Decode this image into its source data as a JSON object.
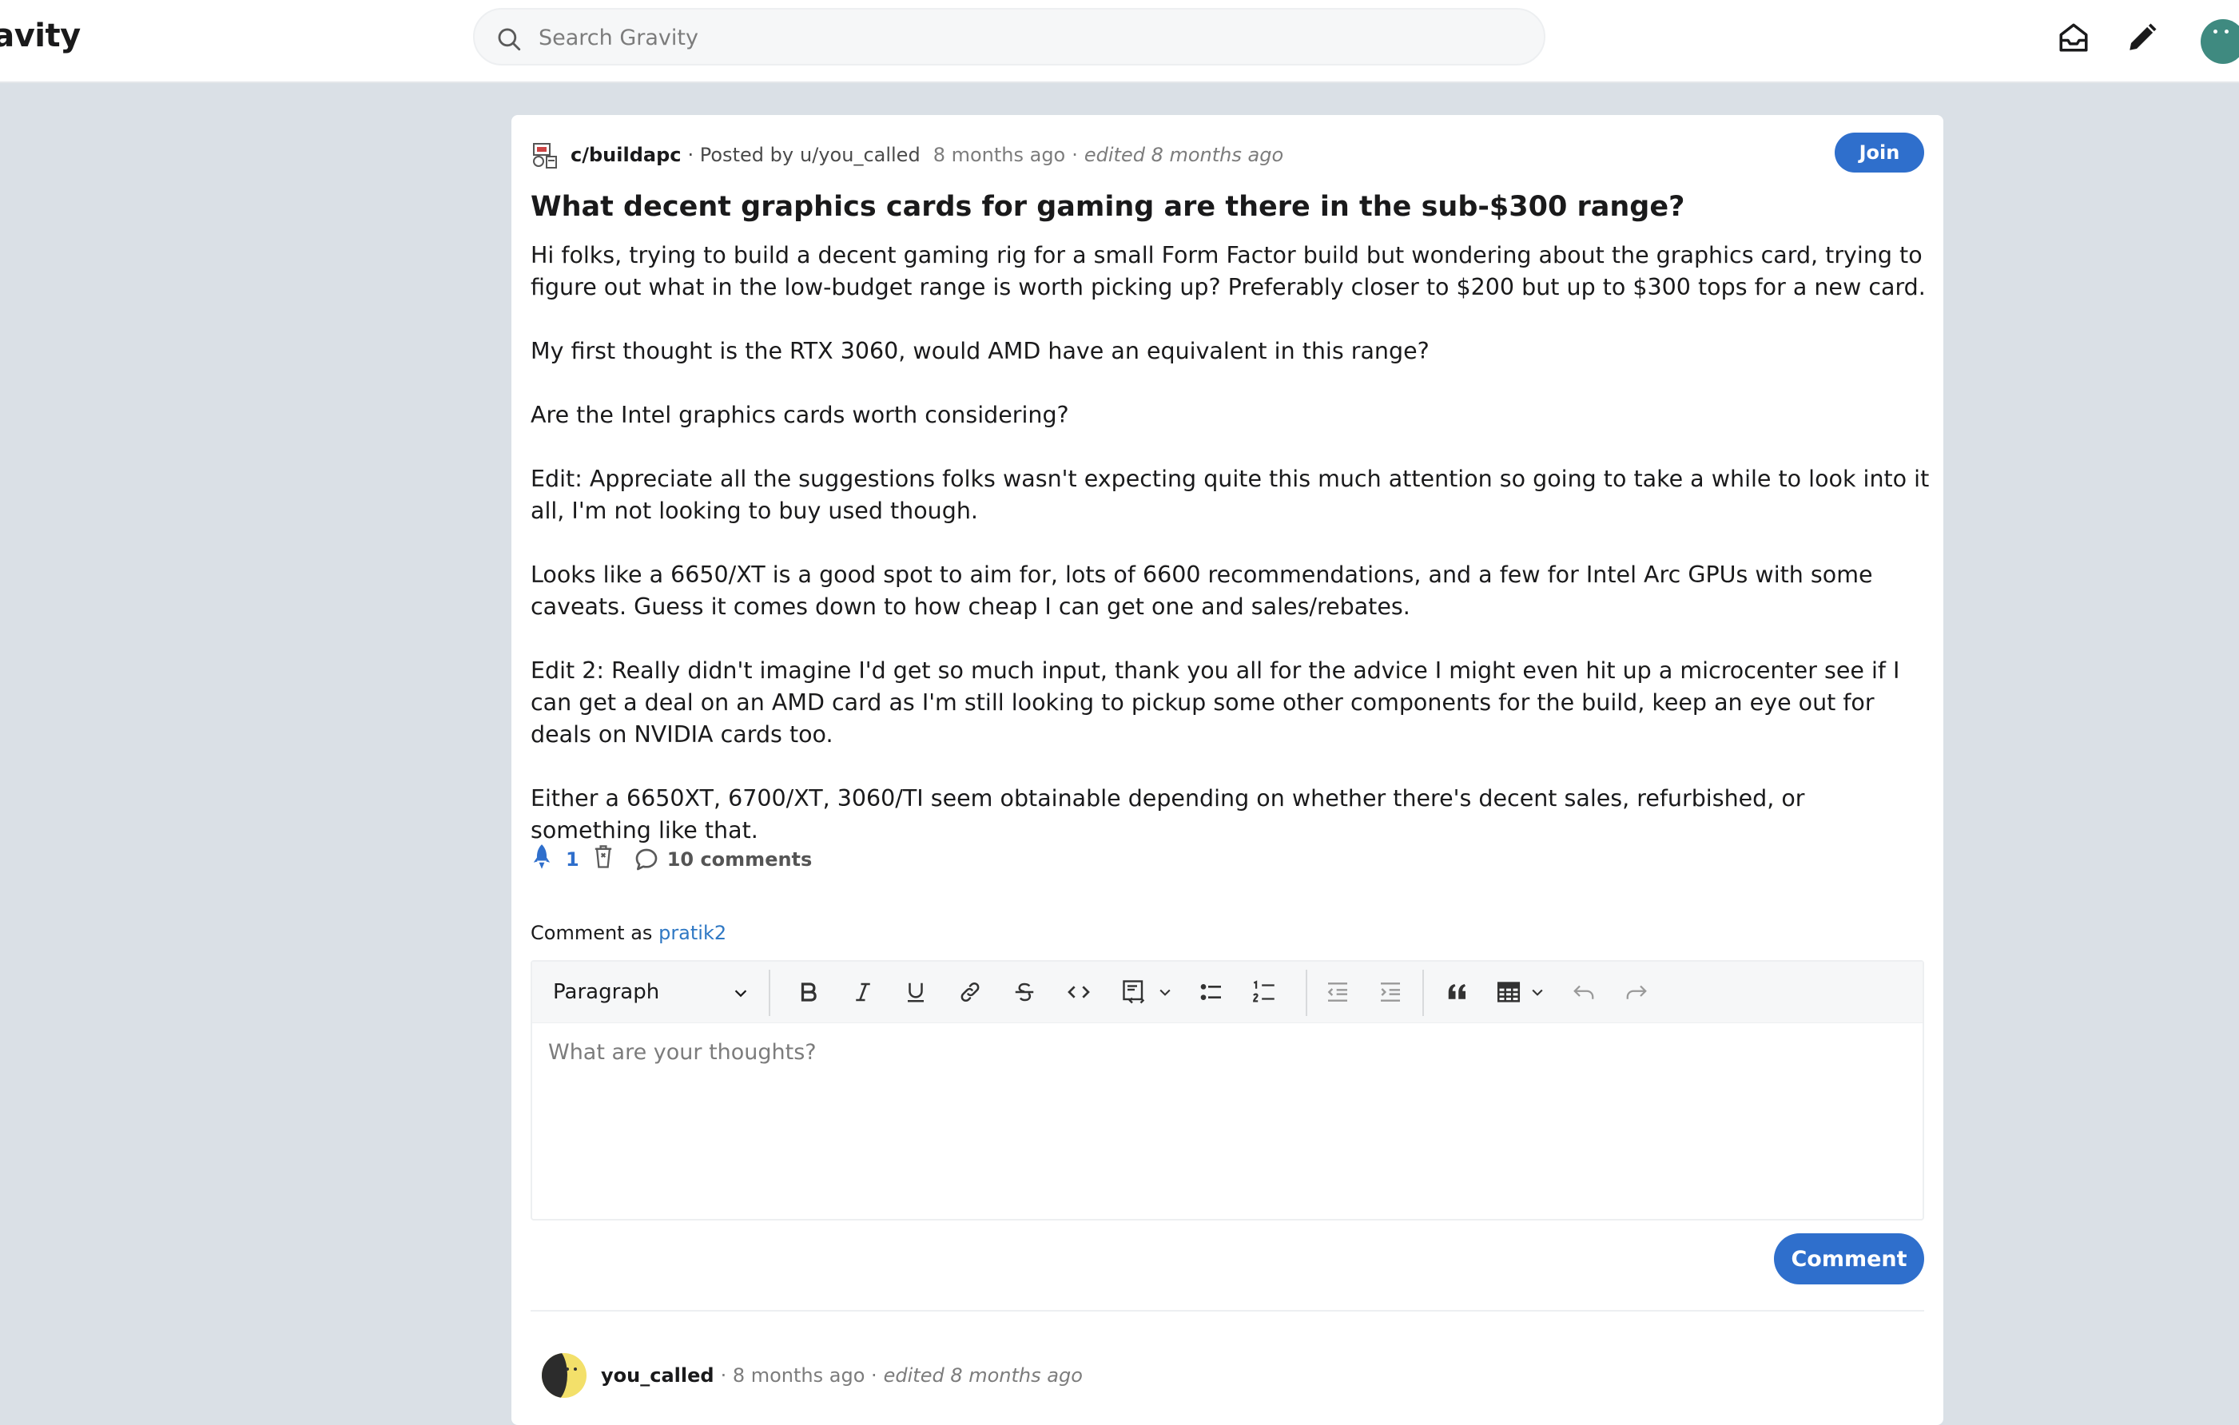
{
  "header": {
    "brand": "ravity",
    "search_placeholder": "Search Gravity"
  },
  "post": {
    "community": "c/buildapc",
    "posted_by_label": "· Posted by",
    "author": "u/you_called",
    "time": "8 months ago",
    "edited_sep": "·",
    "edited": "edited 8 months ago",
    "join_label": "Join",
    "title": "What decent graphics cards for gaming are there in the sub-$300 range?",
    "body": [
      "Hi folks, trying to build a decent gaming rig for a small Form Factor build but wondering about the graphics card, trying to figure out what in the low-budget range is worth picking up? Preferably closer to $200 but up to $300 tops for a new card.",
      "My first thought is the RTX 3060, would AMD have an equivalent in this range?",
      "Are the Intel graphics cards worth considering?",
      "Edit: Appreciate all the suggestions folks wasn't expecting quite this much attention so going to take a while to look into it all, I'm not looking to buy used though.",
      "Looks like a 6650/XT is a good spot to aim for, lots of 6600 recommendations, and a few for Intel Arc GPUs with some caveats. Guess it comes down to how cheap I can get one and sales/rebates.",
      "Edit 2: Really didn't imagine I'd get so much input, thank you all for the advice I might even hit up a microcenter see if I can get a deal on an AMD card as I'm still looking to pickup some other components for the build, keep an eye out for deals on NVIDIA cards too.",
      "Either a 6650XT, 6700/XT, 3060/TI seem obtainable depending on whether there's decent sales, refurbished, or something like that."
    ],
    "vote_count": "1",
    "comments_label": "10 comments"
  },
  "composer": {
    "comment_as_label": "Comment as",
    "username": "pratik2",
    "block_format": "Paragraph",
    "placeholder": "What are your thoughts?",
    "submit_label": "Comment"
  },
  "first_comment": {
    "author": "you_called",
    "time": "· 8 months ago ·",
    "edited": "edited 8 months ago"
  },
  "colors": {
    "accent": "#2f6fcc",
    "link": "#2f78c4",
    "page_bg": "#dae0e6"
  }
}
